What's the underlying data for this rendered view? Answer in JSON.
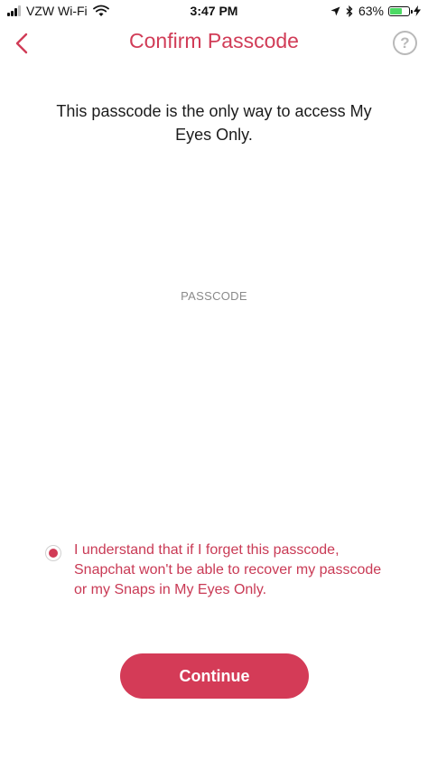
{
  "status_bar": {
    "carrier": "VZW Wi-Fi",
    "time": "3:47 PM",
    "battery_percent": "63%",
    "battery_level": 0.63,
    "icons": [
      "signal-icon",
      "wifi-icon",
      "location-icon",
      "bluetooth-icon",
      "battery-icon",
      "charging-bolt-icon"
    ]
  },
  "nav": {
    "title": "Confirm Passcode",
    "back_icon": "chevron-left-icon",
    "help_label": "?",
    "help_icon": "help-icon"
  },
  "main": {
    "description": "This passcode is the only way to access My Eyes Only.",
    "passcode_label": "PASSCODE",
    "passcode_value": "",
    "agreement_text": "I understand that if I forget this passcode, Snapchat won't be able to recover my passcode or my Snaps in My Eyes Only.",
    "agreement_checked": true,
    "continue_label": "Continue"
  },
  "colors": {
    "accent": "#d13c57",
    "button": "#d43b57",
    "battery": "#4cd964",
    "muted": "#8a8a8a"
  }
}
